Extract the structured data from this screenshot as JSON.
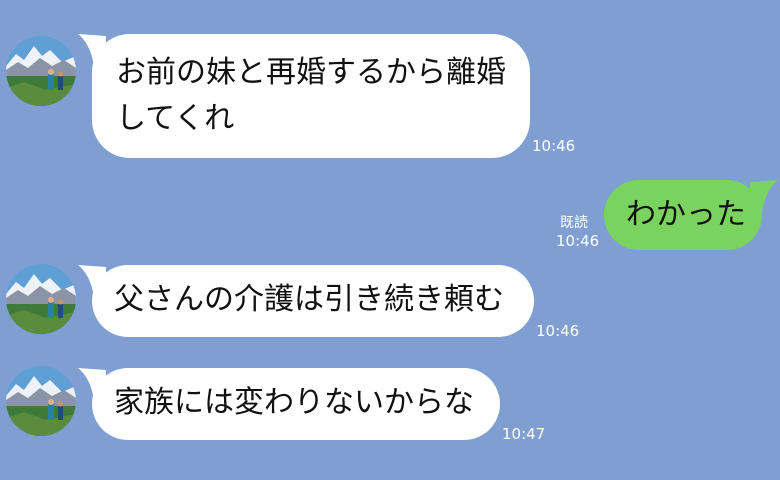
{
  "messages": [
    {
      "side": "left",
      "lines": [
        "お前の妹と再婚するから離婚",
        "してくれ"
      ],
      "time": "10:46"
    },
    {
      "side": "right",
      "text": "わかった",
      "read": "既読",
      "time": "10:46"
    },
    {
      "side": "left",
      "text": "父さんの介護は引き続き頼む",
      "time": "10:46"
    },
    {
      "side": "left",
      "text": "家族には変わりないからな",
      "time": "10:47"
    }
  ],
  "colors": {
    "background": "#7f9fd3",
    "incoming_bubble": "#ffffff",
    "outgoing_bubble": "#7bd35f",
    "meta_text": "#ffffff"
  },
  "icons": {
    "avatar": "mountain-hikers-photo"
  }
}
